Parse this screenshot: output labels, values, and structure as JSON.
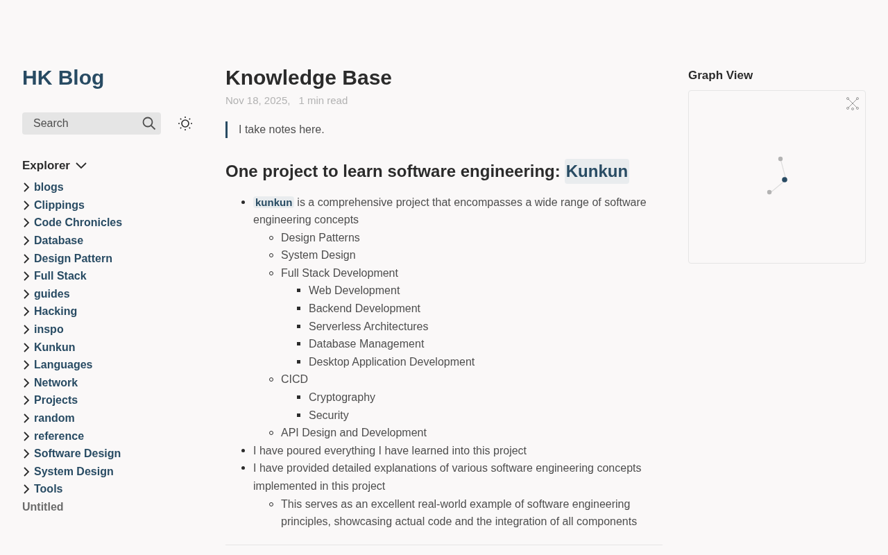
{
  "site_title": "HK Blog",
  "search": {
    "placeholder": "Search"
  },
  "explorer": {
    "title": "Explorer",
    "items": [
      {
        "label": "blogs",
        "kind": "folder"
      },
      {
        "label": "Clippings",
        "kind": "folder"
      },
      {
        "label": "Code Chronicles",
        "kind": "folder"
      },
      {
        "label": "Database",
        "kind": "folder"
      },
      {
        "label": "Design Pattern",
        "kind": "folder"
      },
      {
        "label": "Full Stack",
        "kind": "folder"
      },
      {
        "label": "guides",
        "kind": "folder"
      },
      {
        "label": "Hacking",
        "kind": "folder"
      },
      {
        "label": "inspo",
        "kind": "folder"
      },
      {
        "label": "Kunkun",
        "kind": "folder"
      },
      {
        "label": "Languages",
        "kind": "folder"
      },
      {
        "label": "Network",
        "kind": "folder"
      },
      {
        "label": "Projects",
        "kind": "folder"
      },
      {
        "label": "random",
        "kind": "folder"
      },
      {
        "label": "reference",
        "kind": "folder"
      },
      {
        "label": "Software Design",
        "kind": "folder"
      },
      {
        "label": "System Design",
        "kind": "folder"
      },
      {
        "label": "Tools",
        "kind": "folder"
      },
      {
        "label": "Untitled",
        "kind": "file"
      }
    ]
  },
  "article": {
    "title": "Knowledge Base",
    "date": "Nov 18, 2025,",
    "read_time": "1 min read",
    "quote": "I take notes here.",
    "heading": {
      "text": "One project to learn software engineering:",
      "link": "Kunkun"
    },
    "bullets": [
      {
        "code": "kunkun",
        "text": "is a comprehensive project that encompasses a wide range of software engineering concepts",
        "children": [
          {
            "text": "Design Patterns"
          },
          {
            "text": "System Design"
          },
          {
            "text": "Full Stack Development",
            "children": [
              {
                "text": "Web Development"
              },
              {
                "text": "Backend Development"
              },
              {
                "text": "Serverless Architectures"
              },
              {
                "text": "Database Management"
              },
              {
                "text": "Desktop Application Development"
              }
            ]
          },
          {
            "text": "CICD",
            "children": [
              {
                "text": "Cryptography"
              },
              {
                "text": "Security"
              }
            ]
          },
          {
            "text": "API Design and Development"
          }
        ]
      },
      {
        "text": "I have poured everything I have learned into this project"
      },
      {
        "text": "I have provided detailed explanations of various software engineering concepts implemented in this project",
        "children": [
          {
            "text": "This serves as an excellent real-world example of software engineering principles, showcasing actual code and the integration of all components"
          }
        ]
      }
    ]
  },
  "graph": {
    "title": "Graph View"
  }
}
